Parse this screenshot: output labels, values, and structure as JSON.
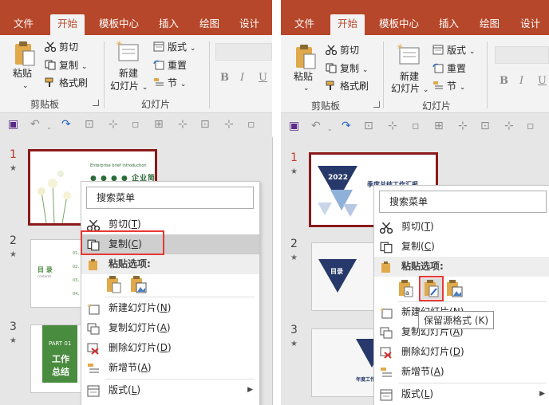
{
  "ribbon": {
    "tabs": [
      "文件",
      "开始",
      "模板中心",
      "插入",
      "绘图",
      "设计"
    ],
    "clipboard": {
      "paste": "粘贴",
      "cut": "剪切",
      "copy": "复制",
      "format_painter": "格式刷",
      "group": "剪贴板"
    },
    "slides": {
      "new_slide_line1": "新建",
      "new_slide_line2": "幻灯片",
      "layout": "版式",
      "reset": "重置",
      "section": "节",
      "group": "幻灯片"
    },
    "font_buttons": [
      "B",
      "I",
      "U"
    ]
  },
  "slides": [
    {
      "number": "1",
      "star": "★"
    },
    {
      "number": "2",
      "star": "★"
    },
    {
      "number": "3",
      "star": "★"
    }
  ],
  "left_thumbs": {
    "t1_small": "Enterprise brief introduction",
    "t1_big": "企业简介",
    "t2_title": "目 录",
    "t2_sub": "contents",
    "t2_items": [
      "01、工作",
      "02、取得",
      "03、存在",
      "04、工作"
    ],
    "t3_part": "PART 01",
    "t3_title_1": "工作",
    "t3_title_2": "总结"
  },
  "right_thumbs": {
    "t1_year": "2022",
    "t1_title": "季度总结工作汇报",
    "t2_title": "目录",
    "t3_text": "年度工作"
  },
  "menu": {
    "header": "搜索菜单",
    "cut": {
      "label": "剪切",
      "key": "(T)",
      "keychar": "T"
    },
    "copy": {
      "label": "复制",
      "key": "(C)",
      "keychar": "C"
    },
    "paste_options": "粘贴选项:",
    "new_slide": {
      "label": "新建幻灯片",
      "keychar": "N"
    },
    "duplicate_slide": {
      "label": "复制幻灯片",
      "keychar": "A"
    },
    "delete_slide": {
      "label": "删除幻灯片",
      "keychar": "D"
    },
    "add_section": {
      "label": "新增节",
      "keychar": "A"
    },
    "layout": {
      "label": "版式",
      "keychar": "L"
    },
    "submenu_arrow": "▶"
  },
  "tooltip": "保留源格式 (K)",
  "colors": {
    "accent": "#b7472a",
    "highlight_box": "#e53935",
    "selected_border": "#8b1a1a",
    "green": "#4a8c3f",
    "navy": "#27396b"
  }
}
